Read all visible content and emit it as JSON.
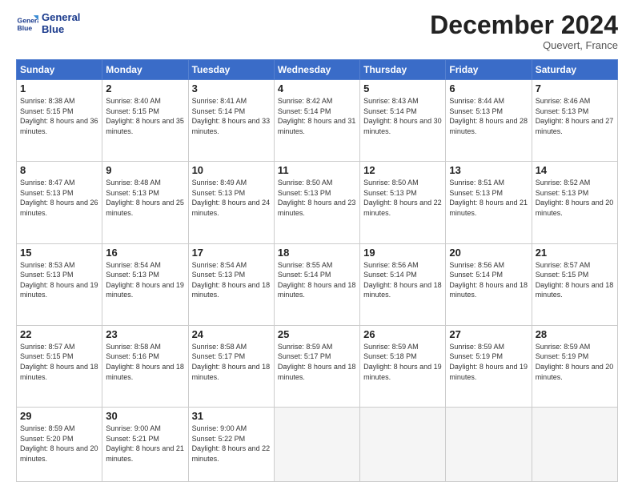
{
  "header": {
    "logo_line1": "General",
    "logo_line2": "Blue",
    "month": "December 2024",
    "location": "Quevert, France"
  },
  "days_of_week": [
    "Sunday",
    "Monday",
    "Tuesday",
    "Wednesday",
    "Thursday",
    "Friday",
    "Saturday"
  ],
  "weeks": [
    [
      {
        "day": "1",
        "sunrise": "Sunrise: 8:38 AM",
        "sunset": "Sunset: 5:15 PM",
        "daylight": "Daylight: 8 hours and 36 minutes."
      },
      {
        "day": "2",
        "sunrise": "Sunrise: 8:40 AM",
        "sunset": "Sunset: 5:15 PM",
        "daylight": "Daylight: 8 hours and 35 minutes."
      },
      {
        "day": "3",
        "sunrise": "Sunrise: 8:41 AM",
        "sunset": "Sunset: 5:14 PM",
        "daylight": "Daylight: 8 hours and 33 minutes."
      },
      {
        "day": "4",
        "sunrise": "Sunrise: 8:42 AM",
        "sunset": "Sunset: 5:14 PM",
        "daylight": "Daylight: 8 hours and 31 minutes."
      },
      {
        "day": "5",
        "sunrise": "Sunrise: 8:43 AM",
        "sunset": "Sunset: 5:14 PM",
        "daylight": "Daylight: 8 hours and 30 minutes."
      },
      {
        "day": "6",
        "sunrise": "Sunrise: 8:44 AM",
        "sunset": "Sunset: 5:13 PM",
        "daylight": "Daylight: 8 hours and 28 minutes."
      },
      {
        "day": "7",
        "sunrise": "Sunrise: 8:46 AM",
        "sunset": "Sunset: 5:13 PM",
        "daylight": "Daylight: 8 hours and 27 minutes."
      }
    ],
    [
      {
        "day": "8",
        "sunrise": "Sunrise: 8:47 AM",
        "sunset": "Sunset: 5:13 PM",
        "daylight": "Daylight: 8 hours and 26 minutes."
      },
      {
        "day": "9",
        "sunrise": "Sunrise: 8:48 AM",
        "sunset": "Sunset: 5:13 PM",
        "daylight": "Daylight: 8 hours and 25 minutes."
      },
      {
        "day": "10",
        "sunrise": "Sunrise: 8:49 AM",
        "sunset": "Sunset: 5:13 PM",
        "daylight": "Daylight: 8 hours and 24 minutes."
      },
      {
        "day": "11",
        "sunrise": "Sunrise: 8:50 AM",
        "sunset": "Sunset: 5:13 PM",
        "daylight": "Daylight: 8 hours and 23 minutes."
      },
      {
        "day": "12",
        "sunrise": "Sunrise: 8:50 AM",
        "sunset": "Sunset: 5:13 PM",
        "daylight": "Daylight: 8 hours and 22 minutes."
      },
      {
        "day": "13",
        "sunrise": "Sunrise: 8:51 AM",
        "sunset": "Sunset: 5:13 PM",
        "daylight": "Daylight: 8 hours and 21 minutes."
      },
      {
        "day": "14",
        "sunrise": "Sunrise: 8:52 AM",
        "sunset": "Sunset: 5:13 PM",
        "daylight": "Daylight: 8 hours and 20 minutes."
      }
    ],
    [
      {
        "day": "15",
        "sunrise": "Sunrise: 8:53 AM",
        "sunset": "Sunset: 5:13 PM",
        "daylight": "Daylight: 8 hours and 19 minutes."
      },
      {
        "day": "16",
        "sunrise": "Sunrise: 8:54 AM",
        "sunset": "Sunset: 5:13 PM",
        "daylight": "Daylight: 8 hours and 19 minutes."
      },
      {
        "day": "17",
        "sunrise": "Sunrise: 8:54 AM",
        "sunset": "Sunset: 5:13 PM",
        "daylight": "Daylight: 8 hours and 18 minutes."
      },
      {
        "day": "18",
        "sunrise": "Sunrise: 8:55 AM",
        "sunset": "Sunset: 5:14 PM",
        "daylight": "Daylight: 8 hours and 18 minutes."
      },
      {
        "day": "19",
        "sunrise": "Sunrise: 8:56 AM",
        "sunset": "Sunset: 5:14 PM",
        "daylight": "Daylight: 8 hours and 18 minutes."
      },
      {
        "day": "20",
        "sunrise": "Sunrise: 8:56 AM",
        "sunset": "Sunset: 5:14 PM",
        "daylight": "Daylight: 8 hours and 18 minutes."
      },
      {
        "day": "21",
        "sunrise": "Sunrise: 8:57 AM",
        "sunset": "Sunset: 5:15 PM",
        "daylight": "Daylight: 8 hours and 18 minutes."
      }
    ],
    [
      {
        "day": "22",
        "sunrise": "Sunrise: 8:57 AM",
        "sunset": "Sunset: 5:15 PM",
        "daylight": "Daylight: 8 hours and 18 minutes."
      },
      {
        "day": "23",
        "sunrise": "Sunrise: 8:58 AM",
        "sunset": "Sunset: 5:16 PM",
        "daylight": "Daylight: 8 hours and 18 minutes."
      },
      {
        "day": "24",
        "sunrise": "Sunrise: 8:58 AM",
        "sunset": "Sunset: 5:17 PM",
        "daylight": "Daylight: 8 hours and 18 minutes."
      },
      {
        "day": "25",
        "sunrise": "Sunrise: 8:59 AM",
        "sunset": "Sunset: 5:17 PM",
        "daylight": "Daylight: 8 hours and 18 minutes."
      },
      {
        "day": "26",
        "sunrise": "Sunrise: 8:59 AM",
        "sunset": "Sunset: 5:18 PM",
        "daylight": "Daylight: 8 hours and 19 minutes."
      },
      {
        "day": "27",
        "sunrise": "Sunrise: 8:59 AM",
        "sunset": "Sunset: 5:19 PM",
        "daylight": "Daylight: 8 hours and 19 minutes."
      },
      {
        "day": "28",
        "sunrise": "Sunrise: 8:59 AM",
        "sunset": "Sunset: 5:19 PM",
        "daylight": "Daylight: 8 hours and 20 minutes."
      }
    ],
    [
      {
        "day": "29",
        "sunrise": "Sunrise: 8:59 AM",
        "sunset": "Sunset: 5:20 PM",
        "daylight": "Daylight: 8 hours and 20 minutes."
      },
      {
        "day": "30",
        "sunrise": "Sunrise: 9:00 AM",
        "sunset": "Sunset: 5:21 PM",
        "daylight": "Daylight: 8 hours and 21 minutes."
      },
      {
        "day": "31",
        "sunrise": "Sunrise: 9:00 AM",
        "sunset": "Sunset: 5:22 PM",
        "daylight": "Daylight: 8 hours and 22 minutes."
      },
      {
        "day": "",
        "sunrise": "",
        "sunset": "",
        "daylight": ""
      },
      {
        "day": "",
        "sunrise": "",
        "sunset": "",
        "daylight": ""
      },
      {
        "day": "",
        "sunrise": "",
        "sunset": "",
        "daylight": ""
      },
      {
        "day": "",
        "sunrise": "",
        "sunset": "",
        "daylight": ""
      }
    ]
  ]
}
